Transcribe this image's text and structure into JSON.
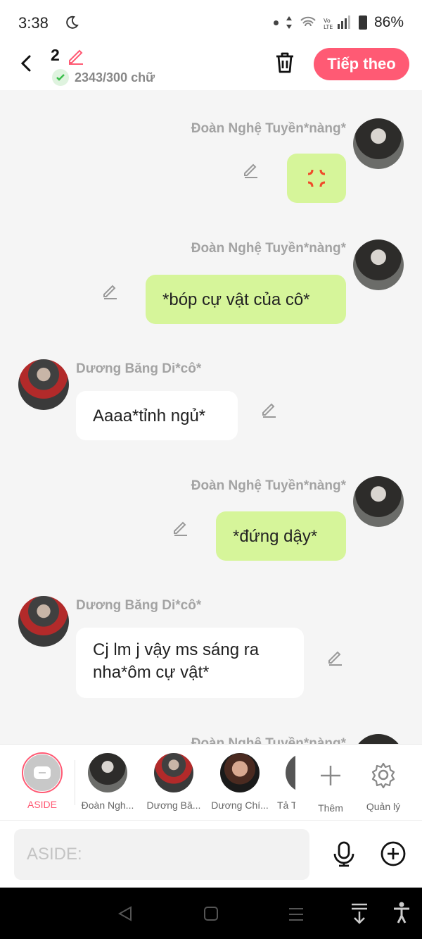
{
  "status": {
    "time": "3:38",
    "battery": "86%"
  },
  "header": {
    "count": "2",
    "word_count": "2343/300 chữ",
    "next_label": "Tiếp theo"
  },
  "messages": [
    {
      "sender": "Đoàn Nghệ Tuyền*nàng*",
      "side": "right",
      "text": "💢"
    },
    {
      "sender": "Đoàn Nghệ Tuyền*nàng*",
      "side": "right",
      "text": "*bóp cự vật của cô*"
    },
    {
      "sender": "Dương Băng Di*cô*",
      "side": "left",
      "text": "Aaaa*tỉnh ngủ*"
    },
    {
      "sender": "Đoàn Nghệ Tuyền*nàng*",
      "side": "right",
      "text": "*đứng dậy*"
    },
    {
      "sender": "Dương Băng Di*cô*",
      "side": "left",
      "text": "Cj lm j vậy ms sáng ra nha*ôm cự vật*"
    },
    {
      "sender": "Đoàn Nghệ Tuyền*nàng*",
      "side": "right",
      "text": ""
    }
  ],
  "tray": {
    "aside_label": "ASIDE",
    "characters": [
      {
        "label": "Đoàn Ngh..."
      },
      {
        "label": "Dương Bă..."
      },
      {
        "label": "Dương Chí..."
      },
      {
        "label": "Tả T"
      }
    ],
    "more_label": "Thêm",
    "manage_label": "Quản lý"
  },
  "input": {
    "placeholder": "ASIDE:"
  }
}
